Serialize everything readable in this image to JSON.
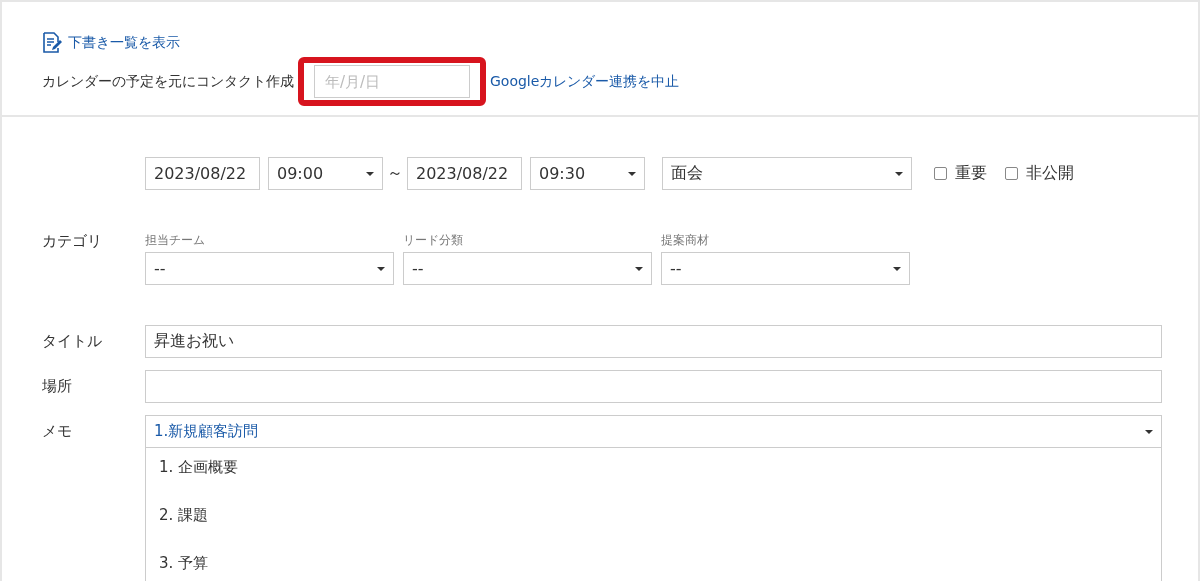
{
  "draft_link": {
    "label": "下書き一覧を表示"
  },
  "calendar": {
    "label": "カレンダーの予定を元にコンタクト作成",
    "date_field": {
      "placeholder": "年/月/日",
      "highlighted": true
    },
    "stop_link": "Googleカレンダー連携を中止"
  },
  "schedule": {
    "start_date": "2023/08/22",
    "start_time": "09:00",
    "separator": "～",
    "end_date": "2023/08/22",
    "end_time": "09:30",
    "type": "面会",
    "flags": [
      {
        "label": "重要",
        "checked": false
      },
      {
        "label": "非公開",
        "checked": false
      }
    ]
  },
  "category": {
    "label": "カテゴリ",
    "selects": [
      {
        "label": "担当チーム",
        "value": "--"
      },
      {
        "label": "リード分類",
        "value": "--"
      },
      {
        "label": "提案商材",
        "value": "--"
      }
    ]
  },
  "title": {
    "label": "タイトル",
    "value": "昇進お祝い"
  },
  "place": {
    "label": "場所"
  },
  "memo": {
    "label": "メモ",
    "template": "1.新規顧客訪問",
    "lines": [
      "1. 企画概要",
      "2. 課題",
      "3. 予算"
    ]
  }
}
